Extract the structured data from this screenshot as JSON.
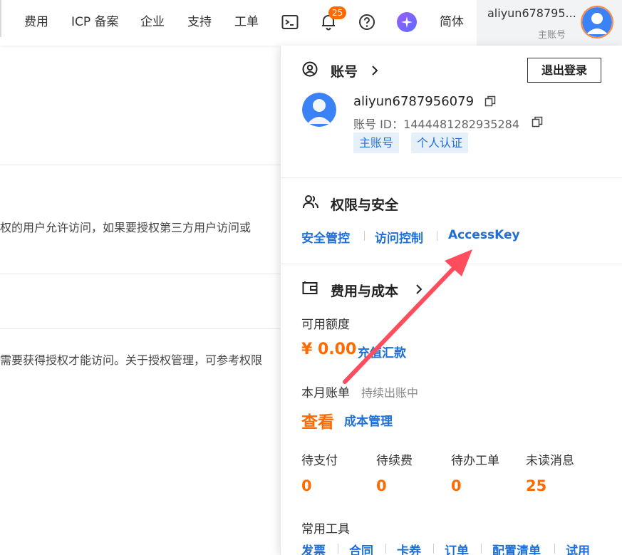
{
  "topbar": {
    "nav": [
      "费用",
      "ICP 备案",
      "企业",
      "支持",
      "工单"
    ],
    "notification_count": "25",
    "language": "简体",
    "username": "aliyun678795...",
    "user_role": "主账号",
    "accent_color": "#ff6a00"
  },
  "background": {
    "line1": "权的用户允许访问，如果要授权第三方用户访问或",
    "line2": "需要获得授权才能访问。关于授权管理，可参考权限"
  },
  "panel": {
    "account": {
      "title": "账号",
      "logout": "退出登录",
      "name": "aliyun6787956079",
      "id_label": "账号 ID：",
      "id_value": "1444481282935284",
      "tags": [
        "主账号",
        "个人认证"
      ]
    },
    "security": {
      "title": "权限与安全",
      "links": [
        "安全管控",
        "访问控制",
        "AccessKey"
      ]
    },
    "billing": {
      "title": "费用与成本",
      "available_label": "可用额度",
      "amount": "¥ 0.00",
      "recharge": "充值汇款",
      "monthly_label": "本月账单",
      "monthly_status": "持续出账中",
      "view": "查看",
      "cost_mgmt": "成本管理",
      "stats": [
        {
          "label": "待支付",
          "value": "0"
        },
        {
          "label": "待续费",
          "value": "0"
        },
        {
          "label": "待办工单",
          "value": "0"
        },
        {
          "label": "未读消息",
          "value": "25"
        }
      ]
    },
    "tools": {
      "title": "常用工具",
      "items": [
        "发票",
        "合同",
        "卡券",
        "订单",
        "配置清单",
        "试用"
      ]
    }
  },
  "colors": {
    "link": "#1f6fd6",
    "annotation_arrow": "#ff4d5e"
  }
}
